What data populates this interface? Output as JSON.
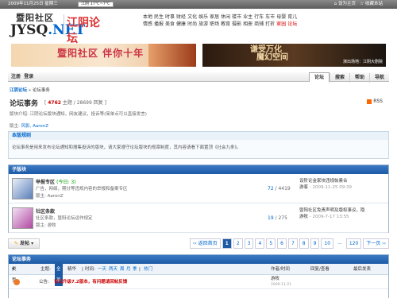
{
  "topbar": {
    "date": "2009年11月25日 星期三",
    "city": "江阴",
    "temp": "17℃~7℃",
    "homepage": "设为主页",
    "favorite": "收藏本站"
  },
  "logo": {
    "cn": "暨阳社区",
    "en_a": "JYSQ",
    "en_b": ".NET",
    "title": "江阴论坛"
  },
  "nav": {
    "row1": [
      "本地",
      "民生",
      "时事",
      "财经",
      "文化",
      "娱乐",
      "家居",
      "休闲",
      "楼市",
      "业主",
      "行车",
      "车市",
      "母婴",
      "育儿"
    ],
    "row2": [
      "情感",
      "播报",
      "美食",
      "健康",
      "时尚",
      "旅游",
      "职场",
      "教育",
      "摄影",
      "相册",
      "商铺",
      "打折"
    ],
    "row2_red": [
      "家园",
      "论坛"
    ]
  },
  "banner1": {
    "text": "暨阳社区 伴你十年"
  },
  "banner2": {
    "text_line1": "谦受万化",
    "text_line2": "魔幻空间",
    "sub": "演出场地：江阴大剧院"
  },
  "tabs": {
    "left": [
      "注册",
      "登录"
    ],
    "right": [
      "论坛",
      "搜索",
      "帮助",
      "导航"
    ]
  },
  "breadcrumb": {
    "home": "江阴论坛",
    "sep": "»",
    "current": "论坛事务"
  },
  "forum": {
    "title": "论坛事务",
    "threads": "4762",
    "threads_label": "主题",
    "posts": "28699",
    "posts_label": "回复",
    "rss": "RSS",
    "desc": "版块介绍: 江阴论坛版块通知，网友建议，投诉等(简单点可以直接发言)",
    "mods_label": "版主:",
    "mods": "风影, AaronZ"
  },
  "notice": {
    "title": "本版规则",
    "body": "论坛事务是用来发布论坛通知和搜集投诉的版块，请大家遵守论坛版块的规章制度，其内容请看下面置顶《社会九条》。"
  },
  "subforums": {
    "header": "子版块",
    "items": [
      {
        "name": "举报专区",
        "today": "(今日: 3)",
        "desc": "广告，网络，期分等违规内容的举报和备案专区",
        "mods": "版主: AaronZ",
        "threads": "72",
        "posts": "4419",
        "last_title": "设阶论金家块违规帖素合",
        "last_user": "游客",
        "last_time": "- 2009-11-25 09:39"
      },
      {
        "name": "社区条款",
        "today": "",
        "desc": "社区条款，暨阳论坛运作规定",
        "mods": "版主: 游牧",
        "threads": "19",
        "posts": "275",
        "last_title": "暨阳社区免责声明及版权事议，隐",
        "last_user": "游牧",
        "last_time": "- 2009-7-17 13:55"
      }
    ]
  },
  "actions": {
    "post_button": "发帖",
    "pager": {
      "prev": "‹‹ 返回首页",
      "current": "1",
      "pages": [
        "2",
        "3",
        "4",
        "5",
        "6",
        "7",
        "8",
        "9",
        "10"
      ],
      "ellipsis": "...",
      "last": "120",
      "next": "下一页 ››"
    }
  },
  "threadlist": {
    "header": "论坛事务",
    "cols": {
      "type": "类型",
      "filter_label": "主题:",
      "all": "全部",
      "digest": "精华",
      "time_label": "时间:",
      "t1": "一天",
      "t2": "两天",
      "t3": "周",
      "t4": "月",
      "t5": "季",
      "hot": "热门",
      "author": "作者/时间",
      "replies": "回复/查看",
      "last": "最后发表"
    },
    "rows": [
      {
        "label": "公告:",
        "title": "论坛升级7.2版本，有问题请回帖反馈",
        "author": "游牧",
        "date": "2009-11-21"
      }
    ]
  }
}
